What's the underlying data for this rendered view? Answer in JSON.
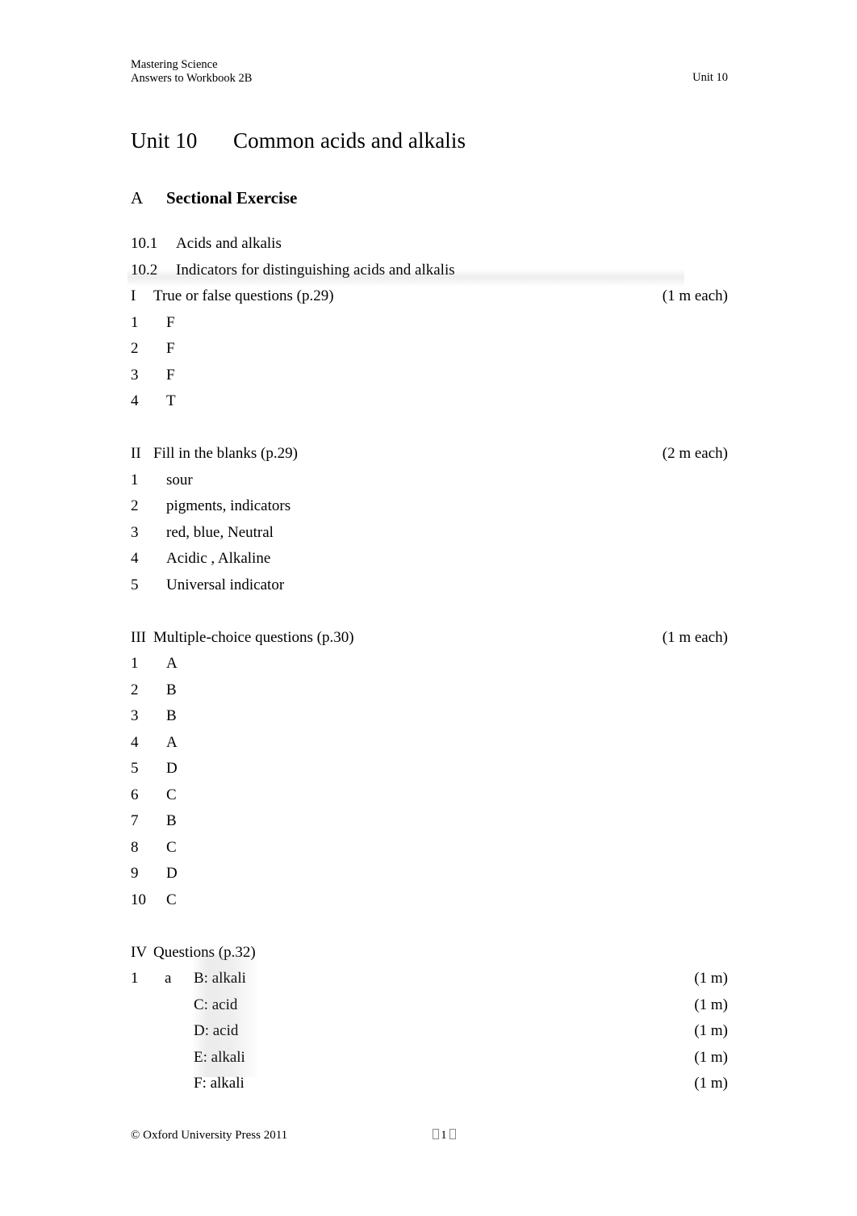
{
  "header": {
    "line1": "Mastering Science",
    "line2": "Answers to Workbook 2B",
    "right": "Unit 10"
  },
  "title": {
    "number": "Unit 10",
    "text": "Common acids and alkalis"
  },
  "section": {
    "letter": "A",
    "name": "Sectional Exercise"
  },
  "subsections": [
    {
      "num": "10.1",
      "text": "Acids and alkalis"
    },
    {
      "num": "10.2",
      "text": "Indicators for distinguishing acids and alkalis"
    }
  ],
  "parts": [
    {
      "roman": "I",
      "title": "True or false questions (p.29)",
      "marks": "(1 m each)",
      "answers": [
        {
          "num": "1",
          "value": "F"
        },
        {
          "num": "2",
          "value": "F"
        },
        {
          "num": "3",
          "value": "F"
        },
        {
          "num": "4",
          "value": "T"
        }
      ]
    },
    {
      "roman": "II",
      "title": "Fill in the blanks (p.29)",
      "marks": "(2 m each)",
      "answers": [
        {
          "num": "1",
          "value": "sour"
        },
        {
          "num": "2",
          "value": "pigments, indicators"
        },
        {
          "num": "3",
          "value": "red, blue, Neutral"
        },
        {
          "num": "4",
          "value": "Acidic , Alkaline"
        },
        {
          "num": "5",
          "value": "Universal indicator"
        }
      ]
    },
    {
      "roman": "III",
      "title": "Multiple-choice questions (p.30)",
      "marks": "(1 m each)",
      "answers": [
        {
          "num": "1",
          "value": "A"
        },
        {
          "num": "2",
          "value": "B"
        },
        {
          "num": "3",
          "value": "B"
        },
        {
          "num": "4",
          "value": "A"
        },
        {
          "num": "5",
          "value": "D"
        },
        {
          "num": "6",
          "value": "C"
        },
        {
          "num": "7",
          "value": "B"
        },
        {
          "num": "8",
          "value": "C"
        },
        {
          "num": "9",
          "value": "D"
        },
        {
          "num": "10",
          "value": "C"
        }
      ]
    },
    {
      "roman": "IV",
      "title": "Questions (p.32)",
      "marks": "",
      "questions": [
        {
          "num": "1",
          "alpha": "a",
          "value": "B: alkali",
          "marks": "(1 m)"
        },
        {
          "num": "",
          "alpha": "",
          "value": "C: acid",
          "marks": "(1 m)"
        },
        {
          "num": "",
          "alpha": "",
          "value": "D: acid",
          "marks": "(1 m)"
        },
        {
          "num": "",
          "alpha": "",
          "value": "E: alkali",
          "marks": "(1 m)"
        },
        {
          "num": "",
          "alpha": "",
          "value": "F: alkali",
          "marks": "(1 m)"
        }
      ]
    }
  ],
  "footer": {
    "copyright": "© Oxford University Press 2011",
    "page_number": "1"
  }
}
